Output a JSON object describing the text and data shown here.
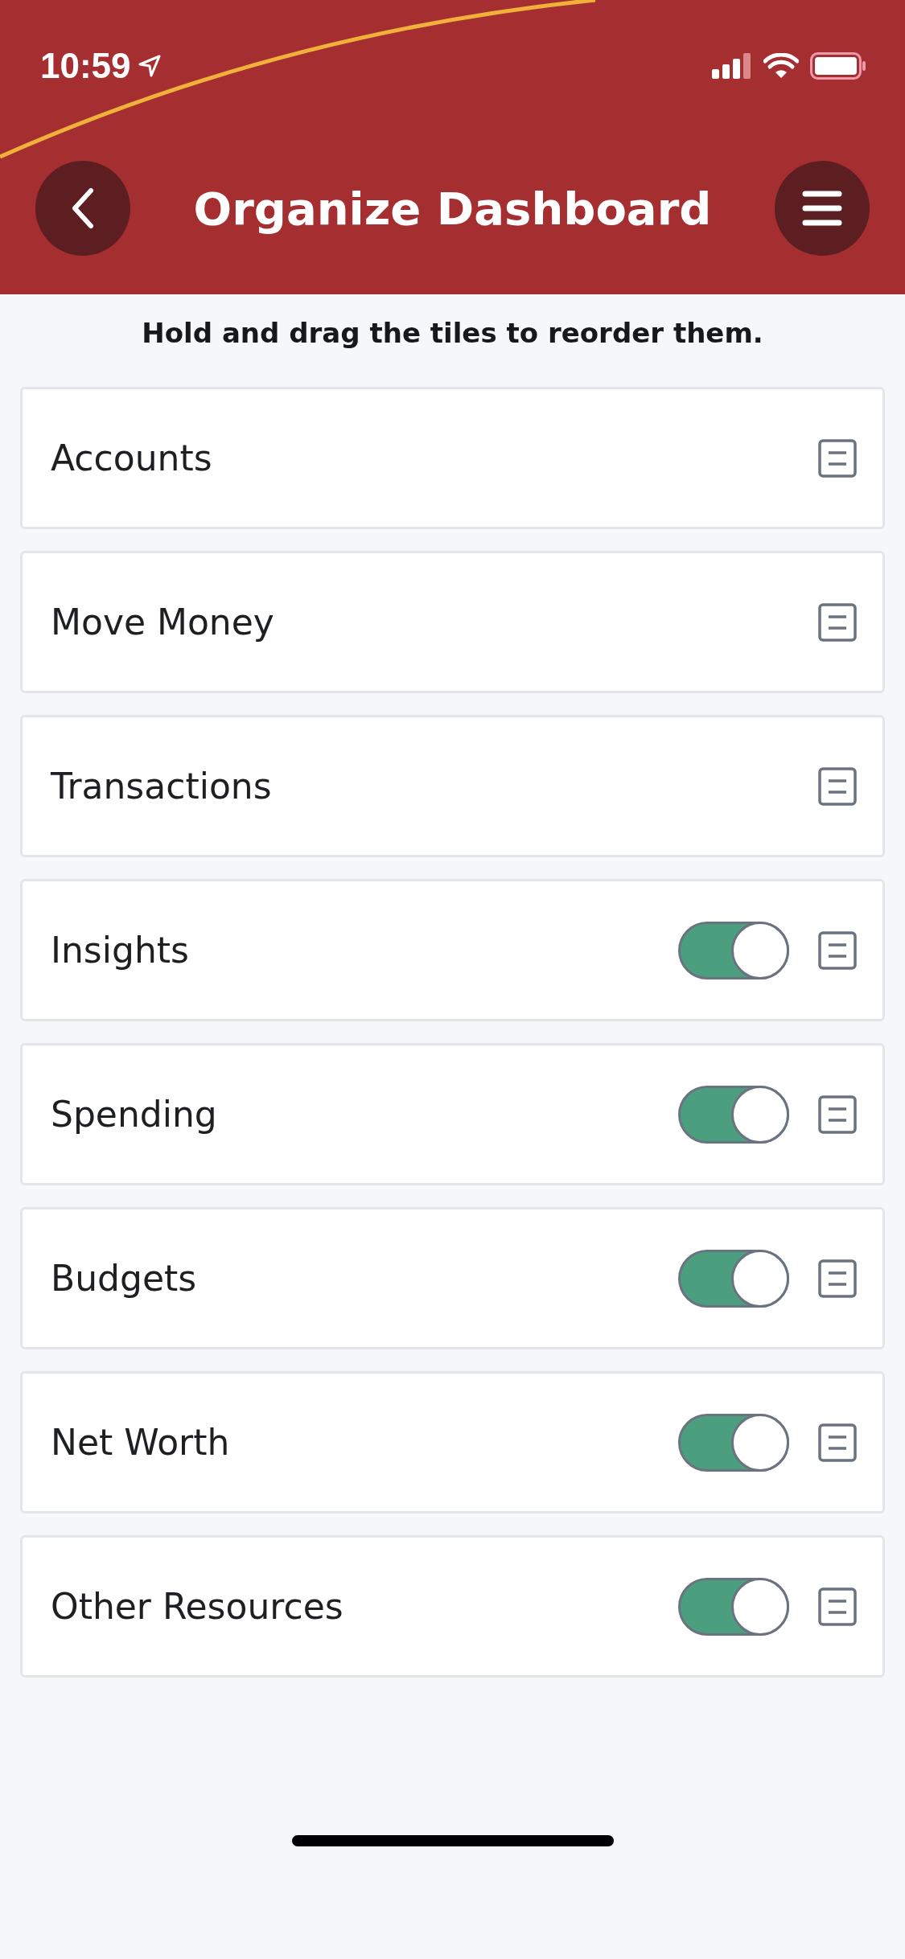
{
  "status_bar": {
    "time": "10:59"
  },
  "header": {
    "title": "Organize Dashboard"
  },
  "instruction": "Hold and drag the tiles to reorder them.",
  "tiles": [
    {
      "label": "Accounts",
      "kind": "fixed"
    },
    {
      "label": "Move Money",
      "kind": "fixed"
    },
    {
      "label": "Transactions",
      "kind": "fixed"
    },
    {
      "label": "Insights",
      "kind": "toggle",
      "on": true
    },
    {
      "label": "Spending",
      "kind": "toggle",
      "on": true
    },
    {
      "label": "Budgets",
      "kind": "toggle",
      "on": true
    },
    {
      "label": "Net Worth",
      "kind": "toggle",
      "on": true
    },
    {
      "label": "Other Resources",
      "kind": "toggle",
      "on": true
    }
  ]
}
